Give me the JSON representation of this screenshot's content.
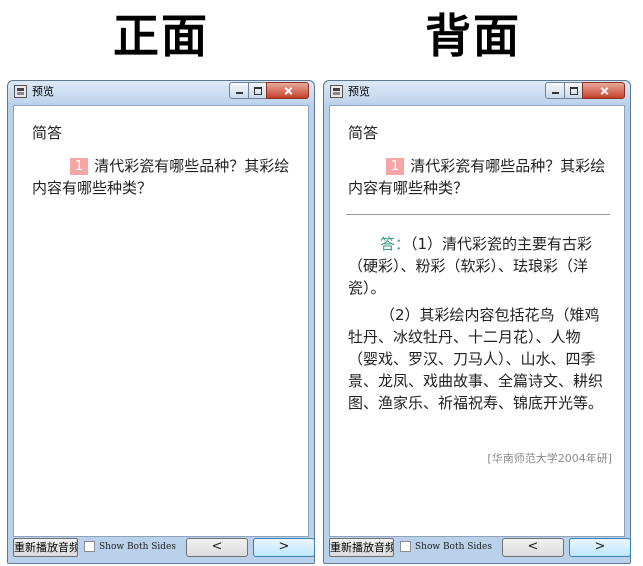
{
  "headings": {
    "front": "正面",
    "back": "背面"
  },
  "window": {
    "title": "预览",
    "icons": {
      "app": "preview-app-icon",
      "minimize": "minimize-icon",
      "maximize": "maximize-icon",
      "close": "close-icon"
    }
  },
  "card": {
    "type_label": "简答",
    "question_number": "1",
    "question_text": "清代彩瓷有哪些品种？其彩绘内容有哪些种类？",
    "answer_label": "答：",
    "answer_part1": "（1）清代彩瓷的主要有古彩（硬彩）、粉彩（软彩）、珐琅彩（洋瓷）。",
    "answer_part2": "（2）其彩绘内容包括花鸟（雉鸡牡丹、冰纹牡丹、十二月花）、人物（婴戏、罗汉、刀马人）、山水、四季景、龙凤、戏曲故事、全篇诗文、耕织图、渔家乐、祈福祝寿、锦底开光等。",
    "source": "[华南师范大学2004年研]"
  },
  "bottombar": {
    "replay_label": "重新播放音频",
    "show_both_sides_label": "Show Both Sides",
    "show_both_sides_checked": false,
    "prev_label": "<",
    "next_label": ">"
  },
  "colors": {
    "question_badge": "#f4a5a5",
    "answer_label": "#3a9a8a",
    "window_frame": "#b9d1ea",
    "source_text": "#8a8a8a"
  }
}
